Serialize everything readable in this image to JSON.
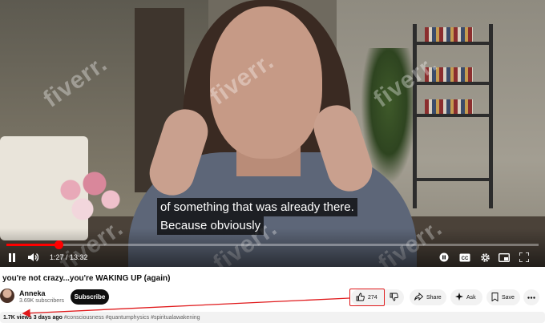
{
  "video": {
    "captions": [
      "of something that was already there.",
      "Because obviously"
    ],
    "watermark": "fiverr.",
    "progress_fraction": 0.098,
    "time_current": "1:27",
    "time_total": "13:32",
    "time_display": "1:27 / 13:32"
  },
  "controls": {
    "play_pause_icon": "pause-icon",
    "volume_icon": "volume-icon",
    "autoplay_icon": "autoplay-toggle-icon",
    "subtitles_icon": "cc-icon",
    "settings_icon": "gear-icon",
    "miniplayer_icon": "miniplayer-icon",
    "fullscreen_icon": "fullscreen-icon"
  },
  "title": "you're not crazy...you're WAKING UP (again)",
  "channel": {
    "name": "Anneka",
    "subscribers": "3.69K subscribers",
    "subscribe_label": "Subscribe"
  },
  "actions": {
    "like_count": "274",
    "share_label": "Share",
    "ask_label": "Ask",
    "save_label": "Save"
  },
  "description": {
    "views": "1.7K views",
    "age": "3 days ago",
    "tags": "#consciousness #quantumphysics #spiritualawakening"
  },
  "annotation": {
    "highlight_color": "#e0191b"
  }
}
